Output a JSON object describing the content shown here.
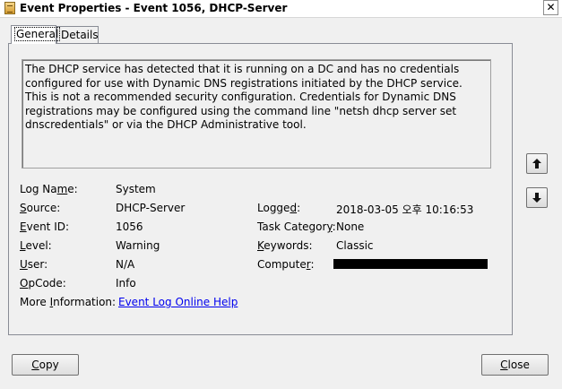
{
  "window": {
    "title": "Event Properties - Event 1056, DHCP-Server",
    "close_glyph": "✕"
  },
  "tabs": [
    {
      "label": "General",
      "selected": true
    },
    {
      "label": "Details",
      "selected": false
    }
  ],
  "description": "The DHCP service has detected that it is running on a DC and has no credentials configured for use with Dynamic DNS registrations initiated by the DHCP service.   This is not a recommended security configuration.  Credentials for Dynamic DNS registrations may be configured using the command line \"netsh dhcp server set dnscredentials\" or via the DHCP Administrative tool.",
  "fields": {
    "log_name": {
      "label_pre": "Log Na",
      "label_key": "m",
      "label_post": "e:",
      "value": "System"
    },
    "source": {
      "label_key": "S",
      "label_post": "ource:",
      "value": "DHCP-Server"
    },
    "event_id": {
      "label_key": "E",
      "label_post": "vent ID:",
      "value": "1056"
    },
    "level": {
      "label_key": "L",
      "label_post": "evel:",
      "value": "Warning"
    },
    "user": {
      "label_key": "U",
      "label_post": "ser:",
      "value": "N/A"
    },
    "opcode": {
      "label_key": "O",
      "label_post": "pCode:",
      "value": "Info"
    },
    "more_info": {
      "label_pre": "More ",
      "label_key": "I",
      "label_post": "nformation:",
      "link": "Event Log Online Help"
    },
    "logged": {
      "label_pre": "Logge",
      "label_key": "d",
      "label_post": ":",
      "value": "2018-03-05 오후 10:16:53"
    },
    "task_category": {
      "label_pre": "Task Categor",
      "label_key": "y",
      "label_post": ":",
      "value": "None"
    },
    "keywords": {
      "label_key": "K",
      "label_post": "eywords:",
      "value": "Classic"
    },
    "computer": {
      "label_pre": "Compute",
      "label_key": "r",
      "label_post": ":",
      "redacted": true
    }
  },
  "buttons": {
    "copy": {
      "label_key": "C",
      "label_post": "opy"
    },
    "close": {
      "label_key": "C",
      "label_post": "lose"
    },
    "up_icon": "arrow-up-icon",
    "down_icon": "arrow-down-icon"
  }
}
